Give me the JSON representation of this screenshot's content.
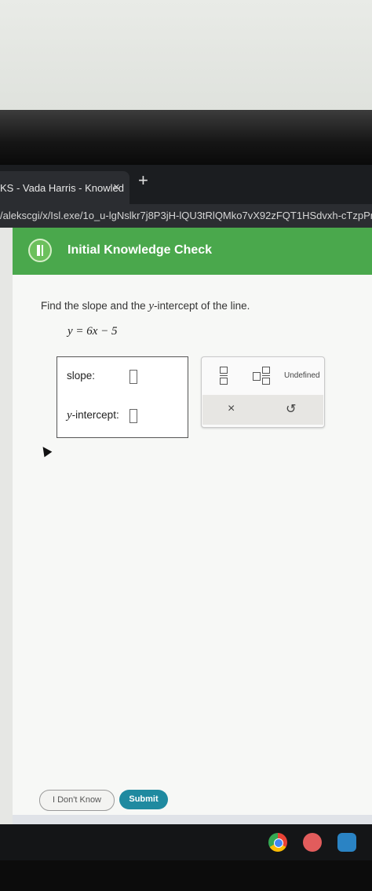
{
  "browser": {
    "tab_title": "KS - Vada Harris - Knowled",
    "tab_close": "×",
    "new_tab": "+",
    "url": "/alekscgi/x/Isl.exe/1o_u-lgNslkr7j8P3jH-lQU3tRlQMko7vX92zFQT1HSdvxh-cTzpPnLF"
  },
  "header": {
    "title": "Initial Knowledge Check"
  },
  "question": {
    "prompt_prefix": "Find the slope and the ",
    "prompt_var": "y",
    "prompt_suffix": "-intercept of the line.",
    "equation": "y = 6x − 5"
  },
  "answers": {
    "slope_label": "slope:",
    "intercept_var": "y",
    "intercept_label": "-intercept:"
  },
  "toolpad": {
    "undefined_label": "Undefined",
    "clear_symbol": "×",
    "undo_symbol": "↺"
  },
  "buttons": {
    "dont_know": "I Don't Know",
    "submit": "Submit"
  },
  "colors": {
    "header_green": "#4aa84c",
    "submit_teal": "#1f8aa0"
  },
  "icons": [
    "menu-icon",
    "fraction-icon",
    "mixed-number-icon",
    "clear-icon",
    "undo-icon",
    "chrome-icon"
  ]
}
